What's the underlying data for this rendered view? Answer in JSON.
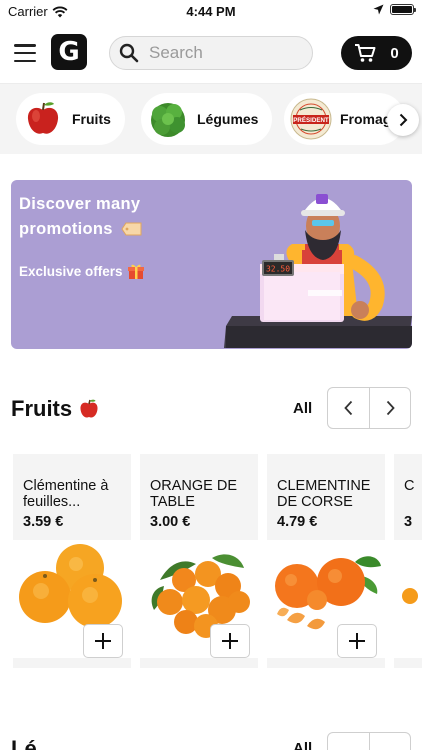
{
  "status_bar": {
    "carrier": "Carrier",
    "time": "4:44 PM"
  },
  "header": {
    "logo_letter": "G",
    "search": {
      "placeholder": "Search",
      "value": ""
    },
    "cart_count": "0"
  },
  "categories": [
    {
      "label": "Fruits",
      "icon": "apple-icon"
    },
    {
      "label": "Légumes",
      "icon": "lettuce-icon"
    },
    {
      "label": "Fromag",
      "icon": "cheese-icon",
      "badge_text": "PRÉSIDENT"
    }
  ],
  "banner": {
    "headline": "Discover many promotions",
    "sub": "Exclusive offers",
    "register_display": "32.50"
  },
  "fruits_section": {
    "title": "Fruits",
    "all_label": "All",
    "products": [
      {
        "name": "Clémentine à feuilles...",
        "price": "3.59 €"
      },
      {
        "name": "ORANGE DE TABLE",
        "price": "3.00 €"
      },
      {
        "name": "CLEMENTINE DE CORSE",
        "price": "4.79 €"
      },
      {
        "name": "C",
        "price": "3"
      }
    ]
  },
  "next_section": {
    "title": "Lé",
    "all_label": "All"
  },
  "colors": {
    "brand": "#111111",
    "banner_bg": "#ab9ed3",
    "orange": "#f39a1c"
  }
}
